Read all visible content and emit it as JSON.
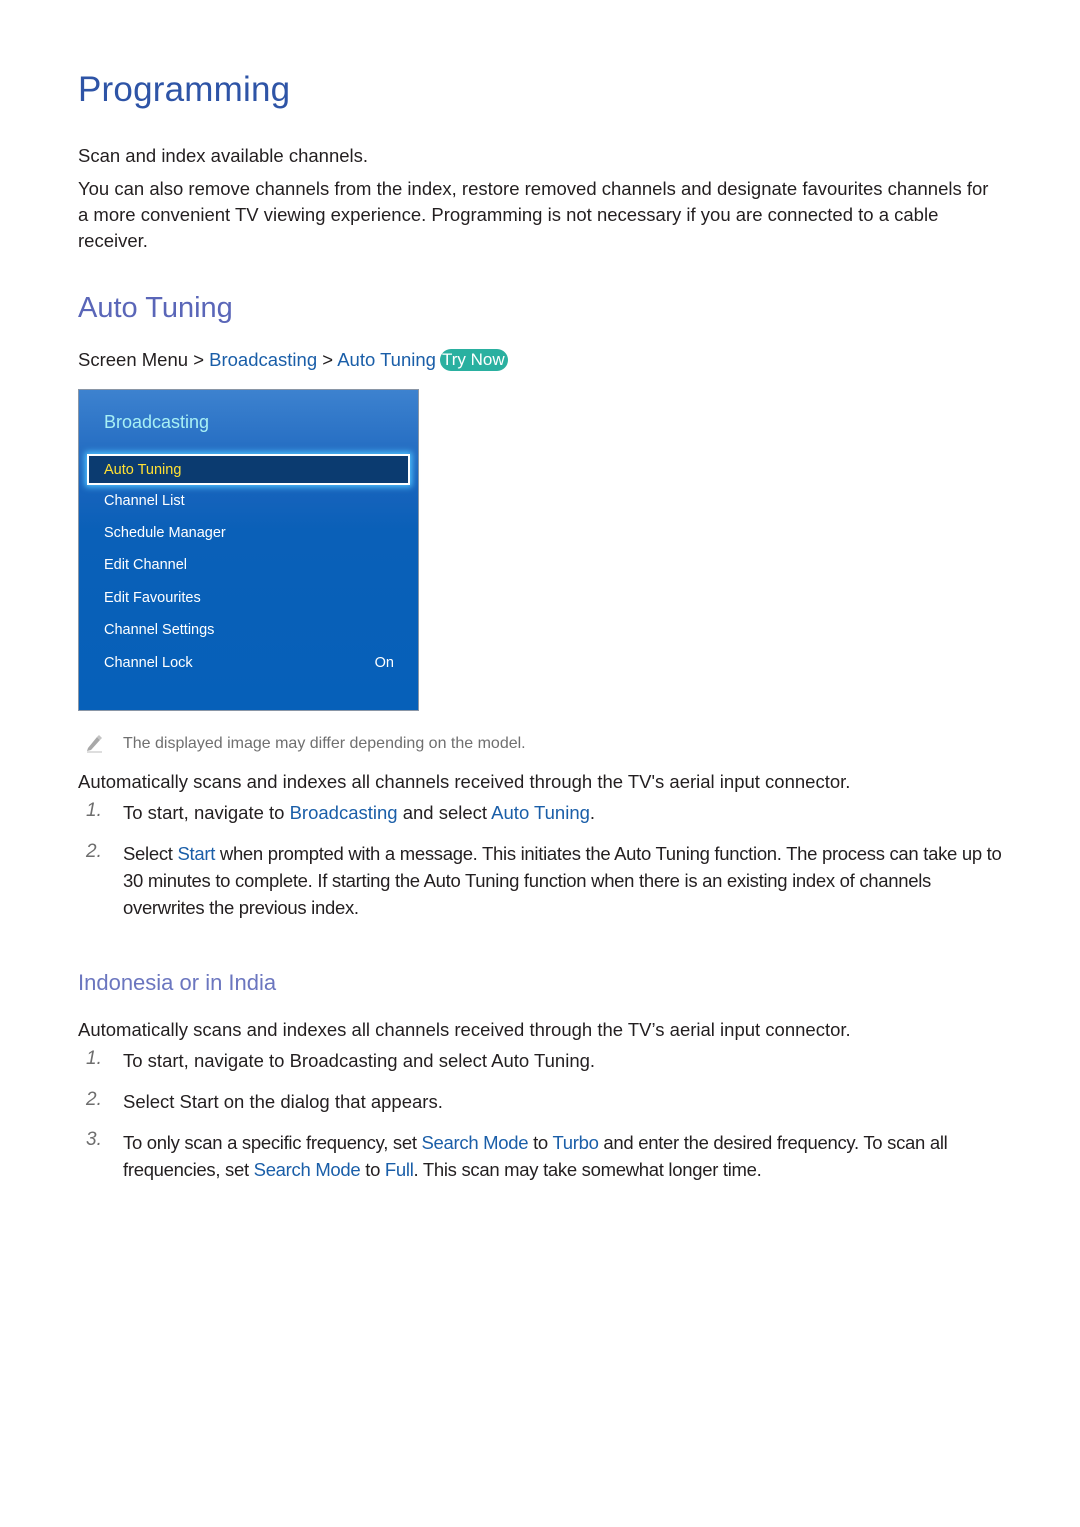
{
  "title": "Programming",
  "intro": {
    "line1": "Scan and index available channels.",
    "line2": "You can also remove channels from the index, restore removed channels and designate favourites channels for a more convenient TV viewing experience. Programming is not necessary if you are connected to a cable receiver."
  },
  "section": {
    "heading": "Auto Tuning",
    "breadcrumb": {
      "root": "Screen Menu",
      "separator": ">",
      "level1": "Broadcasting",
      "level2": "Auto Tuning",
      "try_now": "Try Now"
    },
    "tv_menu": {
      "title": "Broadcasting",
      "items": [
        {
          "label": "Auto Tuning",
          "value": "",
          "selected": true
        },
        {
          "label": "Channel List",
          "value": ""
        },
        {
          "label": "Schedule Manager",
          "value": ""
        },
        {
          "label": "Edit Channel",
          "value": ""
        },
        {
          "label": "Edit Favourites",
          "value": ""
        },
        {
          "label": "Channel Settings",
          "value": ""
        },
        {
          "label": "Channel Lock",
          "value": "On"
        }
      ]
    },
    "note": {
      "icon": "pencil-icon",
      "text": "The displayed image may differ depending on the model."
    },
    "description": "Automatically scans and indexes all channels received through the TV's aerial input connector.",
    "steps": [
      {
        "num": "1.",
        "parts": [
          "To start, navigate to ",
          "Broadcasting",
          " and select ",
          "Auto Tuning",
          "."
        ]
      },
      {
        "num": "2.",
        "parts": [
          "Select ",
          "Start",
          " when prompted with a message. This initiates the Auto Tuning function. The process can take up to 30 minutes to complete. If starting the Auto Tuning function when there is an existing index of channels overwrites the previous index."
        ]
      }
    ]
  },
  "subsection": {
    "heading": "Indonesia or in India",
    "description": "Automatically scans and indexes all channels received through the TV’s aerial input connector.",
    "steps": [
      {
        "num": "1.",
        "text": "To start, navigate to Broadcasting and select Auto Tuning."
      },
      {
        "num": "2.",
        "text": "Select Start on the dialog that appears."
      },
      {
        "num": "3.",
        "parts": [
          "To only scan a specific frequency, set ",
          "Search Mode",
          " to ",
          "Turbo",
          " and enter the desired frequency. To scan all frequencies, set ",
          "Search Mode",
          " to ",
          "Full",
          ". This scan may take somewhat longer time."
        ]
      }
    ]
  },
  "colors": {
    "title": "#2e54a6",
    "heading": "#5a66b8",
    "subheading": "#6b76bf",
    "link": "#1a5ea8",
    "try_now_bg": "#2ab0a0",
    "menu_bg": "#0660b9",
    "menu_selected_bg": "#0b3b70",
    "menu_selected_text": "#ffe033",
    "menu_title": "#a8f0f5"
  }
}
